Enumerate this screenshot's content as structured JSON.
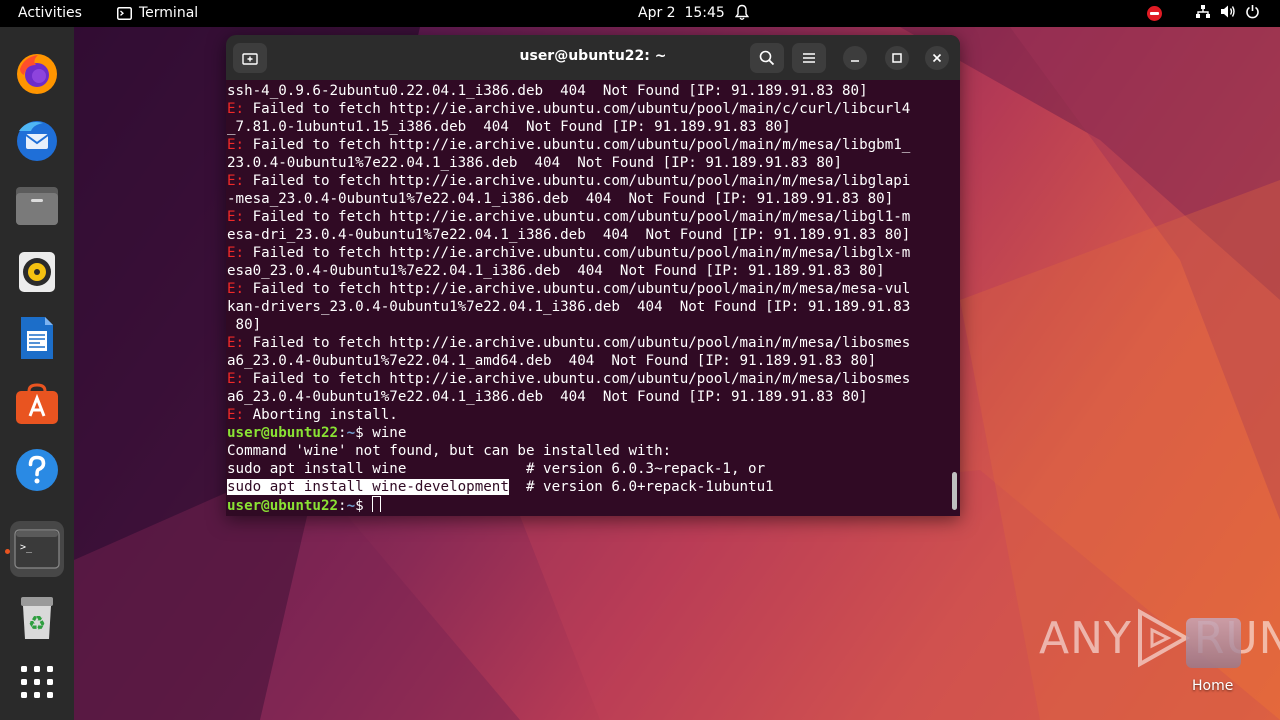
{
  "topbar": {
    "activities": "Activities",
    "app_name": "Terminal",
    "date": "Apr 2",
    "time": "15:45"
  },
  "dock": {
    "items": [
      {
        "name": "firefox-icon"
      },
      {
        "name": "thunderbird-icon"
      },
      {
        "name": "files-icon"
      },
      {
        "name": "rhythmbox-icon"
      },
      {
        "name": "libreoffice-writer-icon"
      },
      {
        "name": "software-icon"
      },
      {
        "name": "help-icon"
      },
      {
        "name": "terminal-icon"
      },
      {
        "name": "trash-icon"
      },
      {
        "name": "show-apps-icon"
      }
    ]
  },
  "terminal": {
    "title": "user@ubuntu22: ~",
    "lines": [
      [
        {
          "t": "ssh-4_0.9.6-2ubuntu0.22.04.1_i386.deb  404  Not Found [IP: 91.189.91.83 80]",
          "c": ""
        }
      ],
      [
        {
          "t": "E: ",
          "c": "err"
        },
        {
          "t": "Failed to fetch http://ie.archive.ubuntu.com/ubuntu/pool/main/c/curl/libcurl4",
          "c": ""
        }
      ],
      [
        {
          "t": "_7.81.0-1ubuntu1.15_i386.deb  404  Not Found [IP: 91.189.91.83 80]",
          "c": ""
        }
      ],
      [
        {
          "t": "E: ",
          "c": "err"
        },
        {
          "t": "Failed to fetch http://ie.archive.ubuntu.com/ubuntu/pool/main/m/mesa/libgbm1_",
          "c": ""
        }
      ],
      [
        {
          "t": "23.0.4-0ubuntu1%7e22.04.1_i386.deb  404  Not Found [IP: 91.189.91.83 80]",
          "c": ""
        }
      ],
      [
        {
          "t": "E: ",
          "c": "err"
        },
        {
          "t": "Failed to fetch http://ie.archive.ubuntu.com/ubuntu/pool/main/m/mesa/libglapi",
          "c": ""
        }
      ],
      [
        {
          "t": "-mesa_23.0.4-0ubuntu1%7e22.04.1_i386.deb  404  Not Found [IP: 91.189.91.83 80]",
          "c": ""
        }
      ],
      [
        {
          "t": "E: ",
          "c": "err"
        },
        {
          "t": "Failed to fetch http://ie.archive.ubuntu.com/ubuntu/pool/main/m/mesa/libgl1-m",
          "c": ""
        }
      ],
      [
        {
          "t": "esa-dri_23.0.4-0ubuntu1%7e22.04.1_i386.deb  404  Not Found [IP: 91.189.91.83 80]",
          "c": ""
        }
      ],
      [
        {
          "t": "E: ",
          "c": "err"
        },
        {
          "t": "Failed to fetch http://ie.archive.ubuntu.com/ubuntu/pool/main/m/mesa/libglx-m",
          "c": ""
        }
      ],
      [
        {
          "t": "esa0_23.0.4-0ubuntu1%7e22.04.1_i386.deb  404  Not Found [IP: 91.189.91.83 80]",
          "c": ""
        }
      ],
      [
        {
          "t": "E: ",
          "c": "err"
        },
        {
          "t": "Failed to fetch http://ie.archive.ubuntu.com/ubuntu/pool/main/m/mesa/mesa-vul",
          "c": ""
        }
      ],
      [
        {
          "t": "kan-drivers_23.0.4-0ubuntu1%7e22.04.1_i386.deb  404  Not Found [IP: 91.189.91.83",
          "c": ""
        }
      ],
      [
        {
          "t": " 80]",
          "c": ""
        }
      ],
      [
        {
          "t": "E: ",
          "c": "err"
        },
        {
          "t": "Failed to fetch http://ie.archive.ubuntu.com/ubuntu/pool/main/m/mesa/libosmes",
          "c": ""
        }
      ],
      [
        {
          "t": "a6_23.0.4-0ubuntu1%7e22.04.1_amd64.deb  404  Not Found [IP: 91.189.91.83 80]",
          "c": ""
        }
      ],
      [
        {
          "t": "E: ",
          "c": "err"
        },
        {
          "t": "Failed to fetch http://ie.archive.ubuntu.com/ubuntu/pool/main/m/mesa/libosmes",
          "c": ""
        }
      ],
      [
        {
          "t": "a6_23.0.4-0ubuntu1%7e22.04.1_i386.deb  404  Not Found [IP: 91.189.91.83 80]",
          "c": ""
        }
      ],
      [
        {
          "t": "E: ",
          "c": "err"
        },
        {
          "t": "Aborting install.",
          "c": ""
        }
      ],
      [
        {
          "t": "user@ubuntu22",
          "c": "prompt"
        },
        {
          "t": ":",
          "c": ""
        },
        {
          "t": "~",
          "c": "path"
        },
        {
          "t": "$ wine",
          "c": ""
        }
      ],
      [
        {
          "t": "Command 'wine' not found, but can be installed with:",
          "c": ""
        }
      ],
      [
        {
          "t": "sudo apt install wine              # version 6.0.3~repack-1, or",
          "c": ""
        }
      ],
      [
        {
          "t": "sudo apt install wine-development",
          "c": "hl"
        },
        {
          "t": "  # version 6.0+repack-1ubuntu1",
          "c": ""
        }
      ],
      [
        {
          "t": "user@ubuntu22",
          "c": "prompt"
        },
        {
          "t": ":",
          "c": ""
        },
        {
          "t": "~",
          "c": "path"
        },
        {
          "t": "$ ",
          "c": ""
        }
      ]
    ]
  },
  "watermark": {
    "brand_left": "ANY",
    "brand_right": "RUN"
  },
  "desktop": {
    "home_label": "Home"
  }
}
